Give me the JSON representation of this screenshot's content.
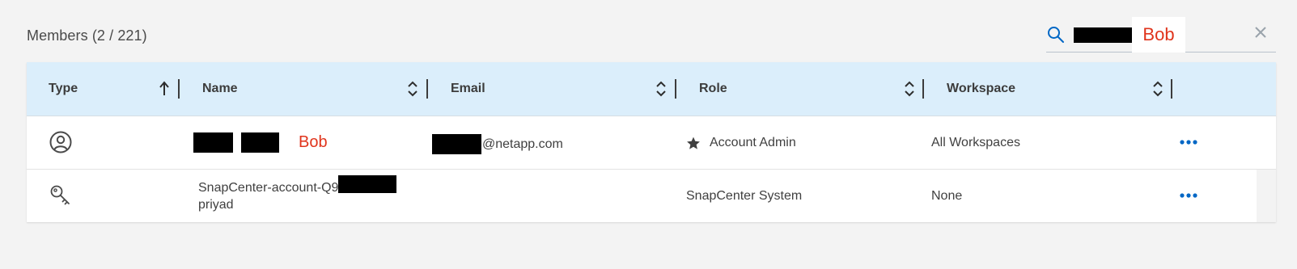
{
  "header": {
    "title": "Members (2 / 221)"
  },
  "search": {
    "value_visible": "Bob",
    "icon": "search-icon",
    "clear_icon": "close-icon"
  },
  "table": {
    "columns": [
      {
        "label": "Type",
        "sort": "ascending"
      },
      {
        "label": "Name",
        "sort": "none"
      },
      {
        "label": "Email",
        "sort": "none"
      },
      {
        "label": "Role",
        "sort": "none"
      },
      {
        "label": "Workspace",
        "sort": "none"
      }
    ],
    "rows": [
      {
        "type_icon": "user-circle-icon",
        "name_suffix": "Bob",
        "email_suffix": "@netapp.com",
        "role_icon": "star-icon",
        "role": "Account Admin",
        "workspace": "All Workspaces",
        "actions_icon": "more-icon"
      },
      {
        "type_icon": "key-icon",
        "name_line1": "SnapCenter-account-Q9",
        "name_line2": "priyad",
        "email": "",
        "role": "SnapCenter System",
        "workspace": "None",
        "actions_icon": "more-icon"
      }
    ]
  },
  "colors": {
    "header_bg": "#dbeefb",
    "accent_blue": "#0067c5",
    "highlight_red": "#e0341c"
  }
}
